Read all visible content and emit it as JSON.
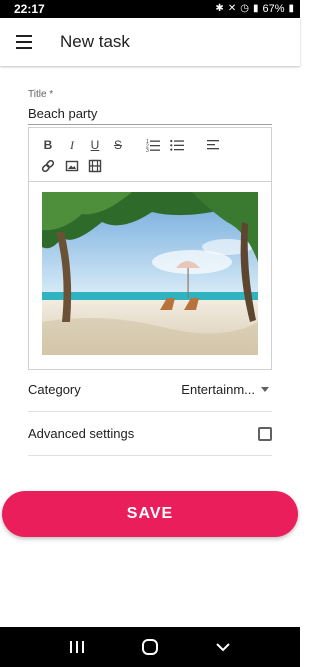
{
  "status_bar": {
    "time": "22:17",
    "battery": "67%"
  },
  "app_bar": {
    "title": "New task"
  },
  "form": {
    "title_label": "Title *",
    "title_value": "Beach party",
    "category_label": "Category",
    "category_value": "Entertainm...",
    "advanced_label": "Advanced settings",
    "advanced_checked": false,
    "save_label": "SAVE"
  },
  "editor_toolbar": {
    "bold": "B",
    "italic": "I",
    "underline": "U",
    "strikethrough": "S"
  },
  "colors": {
    "accent": "#e91e5a",
    "status_bar": "#000000",
    "nav_bar": "#000000"
  }
}
